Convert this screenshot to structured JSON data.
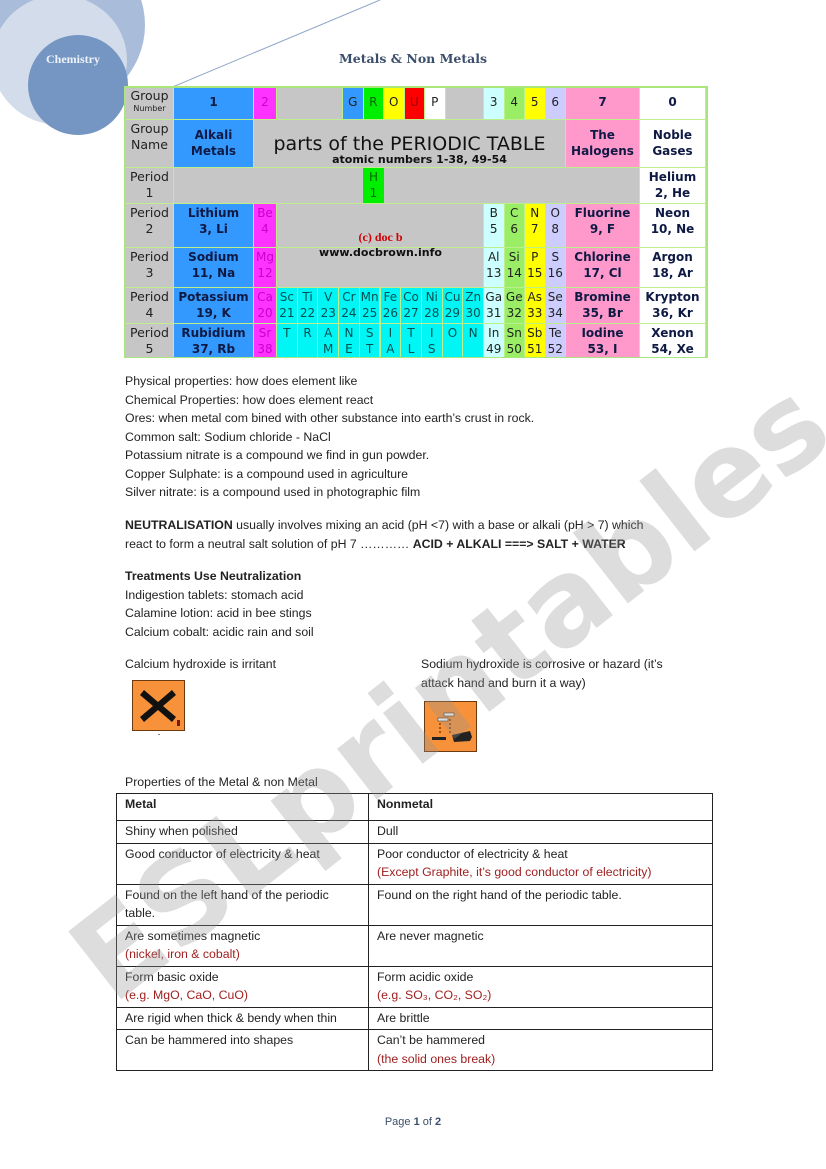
{
  "header": {
    "brand": "Chemistry",
    "title": "Metals & Non Metals"
  },
  "periodic_table": {
    "row_labels": {
      "group_number": "Group",
      "group_number_sub": "Number",
      "group_name_1": "Group",
      "group_name_2": "Name",
      "period": "Period"
    },
    "group_numbers": {
      "g1": "1",
      "g2": "2",
      "g3": "3",
      "g4": "4",
      "g5": "5",
      "g6": "6",
      "g7": "7",
      "g0": "0"
    },
    "group_letters": [
      "G",
      "R",
      "O",
      "U",
      "P"
    ],
    "group_names": {
      "alkali_1": "Alkali",
      "alkali_2": "Metals",
      "halogens_1": "The",
      "halogens_2": "Halogens",
      "noble_1": "Noble",
      "noble_2": "Gases"
    },
    "title": "parts of the PERIODIC TABLE",
    "subtitle": "atomic numbers 1-38, 49-54",
    "credit": "(c) doc b",
    "website": "www.docbrown.info",
    "periods": [
      "1",
      "2",
      "3",
      "4",
      "5"
    ],
    "hydrogen": {
      "symbol": "H",
      "number": "1"
    },
    "helium": {
      "name": "Helium",
      "info": "2, He"
    },
    "alkali": [
      {
        "name": "Lithium",
        "info": "3, Li"
      },
      {
        "name": "Sodium",
        "info": "11, Na"
      },
      {
        "name": "Potassium",
        "info": "19, K"
      },
      {
        "name": "Rubidium",
        "info": "37, Rb"
      }
    ],
    "group2": [
      {
        "symbol": "Be",
        "number": "4"
      },
      {
        "symbol": "Mg",
        "number": "12"
      },
      {
        "symbol": "Ca",
        "number": "20"
      },
      {
        "symbol": "Sr",
        "number": "38"
      }
    ],
    "transition_p4": [
      {
        "symbol": "Sc",
        "number": "21"
      },
      {
        "symbol": "Ti",
        "number": "22"
      },
      {
        "symbol": "V",
        "number": "23"
      },
      {
        "symbol": "Cr",
        "number": "24"
      },
      {
        "symbol": "Mn",
        "number": "25"
      },
      {
        "symbol": "Fe",
        "number": "26"
      },
      {
        "symbol": "Co",
        "number": "27"
      },
      {
        "symbol": "Ni",
        "number": "28"
      },
      {
        "symbol": "Cu",
        "number": "29"
      },
      {
        "symbol": "Zn",
        "number": "30"
      }
    ],
    "transition_p5_top": [
      "T",
      "R",
      "A",
      "N",
      "S",
      "I",
      "T",
      "I",
      "O",
      "N"
    ],
    "transition_p5_bottom": [
      "",
      "",
      "M",
      "E",
      "T",
      "A",
      "L",
      "S",
      "",
      ""
    ],
    "pblock": [
      [
        {
          "symbol": "B",
          "number": "5"
        },
        {
          "symbol": "C",
          "number": "6"
        },
        {
          "symbol": "N",
          "number": "7"
        },
        {
          "symbol": "O",
          "number": "8"
        }
      ],
      [
        {
          "symbol": "Al",
          "number": "13"
        },
        {
          "symbol": "Si",
          "number": "14"
        },
        {
          "symbol": "P",
          "number": "15"
        },
        {
          "symbol": "S",
          "number": "16"
        }
      ],
      [
        {
          "symbol": "Ga",
          "number": "31"
        },
        {
          "symbol": "Ge",
          "number": "32"
        },
        {
          "symbol": "As",
          "number": "33"
        },
        {
          "symbol": "Se",
          "number": "34"
        }
      ],
      [
        {
          "symbol": "In",
          "number": "49"
        },
        {
          "symbol": "Sn",
          "number": "50"
        },
        {
          "symbol": "Sb",
          "number": "51"
        },
        {
          "symbol": "Te",
          "number": "52"
        }
      ]
    ],
    "halogens": [
      {
        "name": "Fluorine",
        "info": "9, F"
      },
      {
        "name": "Chlorine",
        "info": "17, Cl"
      },
      {
        "name": "Bromine",
        "info": "35, Br"
      },
      {
        "name": "Iodine",
        "info": "53, I"
      }
    ],
    "noble": [
      {
        "name": "Neon",
        "info": "10, Ne"
      },
      {
        "name": "Argon",
        "info": "18, Ar"
      },
      {
        "name": "Krypton",
        "info": "36, Kr"
      },
      {
        "name": "Xenon",
        "info": "54, Xe"
      }
    ]
  },
  "definitions": [
    "Physical properties: how does element like",
    "Chemical Properties: how does element react",
    "Ores: when metal com bined with other substance into earth’s crust in rock.",
    "Common salt:  Sodium chloride - NaCl",
    "Potassium nitrate is a compound we find in gun powder.",
    "Copper Sulphate: is a compound used in agriculture",
    "Silver nitrate: is a compound used in photographic film"
  ],
  "neutralisation": {
    "term": "NEUTRALISATION",
    "text1": " usually involves mixing an acid (pH <7) with a base or alkali (pH > 7) which",
    "text2": "react to form  a neutral salt solution of pH 7  ………… ",
    "equation": "ACID + ALKALI ===> SALT + WATER"
  },
  "treatments": {
    "heading": "Treatments Use Neutralization",
    "items": [
      "Indigestion tablets: stomach acid",
      "Calamine lotion: acid in bee stings",
      "Calcium cobalt:  acidic rain and soil"
    ]
  },
  "hazards": {
    "irritant_caption": "Calcium hydroxide is irritant",
    "corrosive_caption_1": "Sodium hydroxide is corrosive or hazard (it’s",
    "corrosive_caption_2": "attack hand and burn it a way)"
  },
  "properties_table": {
    "caption": "Properties of the Metal & non Metal",
    "headers": [
      "Metal",
      "Nonmetal"
    ],
    "rows": [
      {
        "metal": "Shiny when polished",
        "metal_note": "",
        "nonmetal": "Dull",
        "nonmetal_note": ""
      },
      {
        "metal": "Good conductor of electricity & heat",
        "metal_note": "",
        "nonmetal": "Poor conductor of electricity & heat",
        "nonmetal_note": "(Except Graphite, it’s good conductor of electricity)"
      },
      {
        "metal": "Found on the left hand of the periodic table.",
        "metal_note": "",
        "nonmetal": "Found on the right hand of the periodic table.",
        "nonmetal_note": ""
      },
      {
        "metal": "Are sometimes magnetic",
        "metal_note": "(nickel, iron & cobalt)",
        "nonmetal": "Are never magnetic",
        "nonmetal_note": ""
      },
      {
        "metal": "Form basic oxide",
        "metal_note": "(e.g. MgO, CaO, CuO)",
        "nonmetal": "Form acidic oxide",
        "nonmetal_note": "(e.g. SO₃, CO₂, SO₂)"
      },
      {
        "metal": "Are rigid when thick & bendy when thin",
        "metal_note": "",
        "nonmetal": "Are brittle",
        "nonmetal_note": ""
      },
      {
        "metal": "Can be hammered into shapes",
        "metal_note": "",
        "nonmetal": "Can’t be hammered",
        "nonmetal_note": "(the solid ones break)"
      }
    ]
  },
  "footer": {
    "prefix": "Page ",
    "current": "1",
    "middle": " of ",
    "total": "2"
  },
  "watermark": "ESLprintables.com"
}
